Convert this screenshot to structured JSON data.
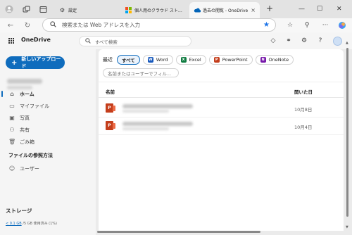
{
  "browser": {
    "tabs": [
      {
        "title": "設定",
        "active": false
      },
      {
        "title": "個人用のクラウド ストレージ - Micros",
        "active": false
      },
      {
        "title": "過去の閲覧 - OneDrive",
        "active": true
      }
    ],
    "new_tab_label": "+",
    "address_placeholder": "検索または Web アドレスを入力"
  },
  "onedrive": {
    "brand": "OneDrive",
    "search_placeholder": "すべて検索",
    "new_button": "新しいアップロード",
    "nav": [
      {
        "label": "ホーム",
        "icon": "home-icon",
        "active": true
      },
      {
        "label": "マイファイル",
        "icon": "folder-icon",
        "active": false
      },
      {
        "label": "写真",
        "icon": "photo-icon",
        "active": false
      },
      {
        "label": "共有",
        "icon": "share-icon",
        "active": false
      },
      {
        "label": "ごみ箱",
        "icon": "trash-icon",
        "active": false
      }
    ],
    "browse_section": "ファイルの参照方法",
    "people_item": "ユーザー",
    "storage_title": "ストレージ",
    "storage_used": "< 0.1 GB",
    "storage_detail": "/5 GB 使用済み (1%)"
  },
  "main": {
    "recent_label": "最近",
    "filters": [
      {
        "label": "すべて",
        "selected": true,
        "icon": null
      },
      {
        "label": "Word",
        "selected": false,
        "icon": "W",
        "color": "#185abd"
      },
      {
        "label": "Excel",
        "selected": false,
        "icon": "X",
        "color": "#107c41"
      },
      {
        "label": "PowerPoint",
        "selected": false,
        "icon": "P",
        "color": "#c43e1c"
      },
      {
        "label": "OneNote",
        "selected": false,
        "icon": "N",
        "color": "#7719aa"
      }
    ],
    "name_filter_placeholder": "名前またはユーザーでフィル...",
    "columns": {
      "name": "名前",
      "opened": "開いた日"
    },
    "files": [
      {
        "type": "powerpoint",
        "date": "10月8日"
      },
      {
        "type": "powerpoint",
        "date": "10月4日"
      }
    ]
  }
}
